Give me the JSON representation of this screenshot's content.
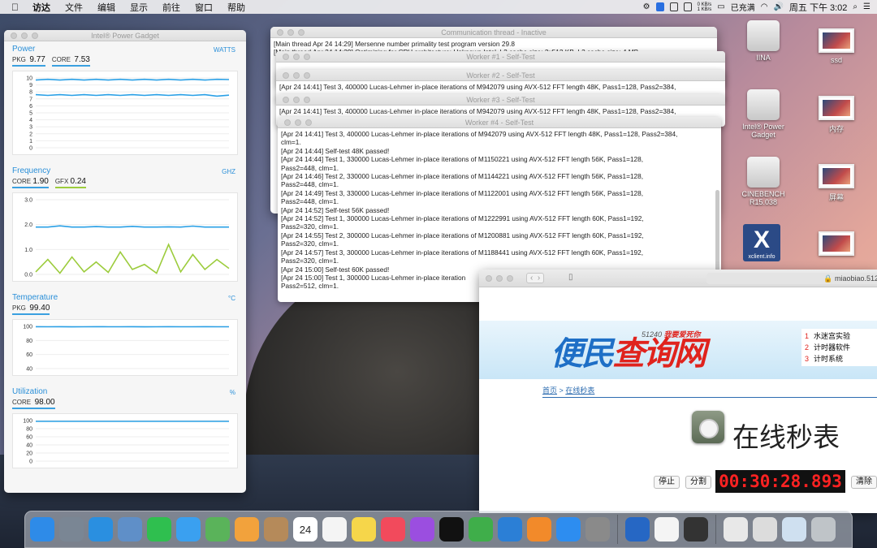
{
  "menubar": {
    "apple_icon": "apple-logo",
    "items": [
      "访达",
      "文件",
      "编辑",
      "显示",
      "前往",
      "窗口",
      "帮助"
    ],
    "net_up": "0 KB/s",
    "net_down": "1 KB/s",
    "battery": "已充满",
    "clock": "周五 下午 3:02"
  },
  "power_gadget": {
    "title": "Intel® Power Gadget",
    "power": {
      "title": "Power",
      "unit": "WATTS",
      "pkg_label": "PKG",
      "pkg_value": "9.77",
      "core_label": "CORE",
      "core_value": "7.53",
      "yticks": [
        "10",
        "9",
        "8",
        "7",
        "6",
        "5",
        "4",
        "3",
        "2",
        "1",
        "0"
      ]
    },
    "frequency": {
      "title": "Frequency",
      "unit": "GHZ",
      "core_label": "CORE",
      "core_value": "1.90",
      "gfx_label": "GFX",
      "gfx_value": "0.24",
      "yticks": [
        "3.0",
        "2.0",
        "1.0",
        "0.0"
      ]
    },
    "temperature": {
      "title": "Temperature",
      "unit": "°C",
      "pkg_label": "PKG",
      "pkg_value": "99.40",
      "yticks": [
        "100",
        "80",
        "60",
        "40"
      ]
    },
    "utilization": {
      "title": "Utilization",
      "unit": "%",
      "core_label": "CORE",
      "core_value": "98.00",
      "yticks": [
        "100",
        "80",
        "60",
        "40",
        "20",
        "0"
      ]
    }
  },
  "chart_data": [
    {
      "type": "line",
      "title": "Power",
      "ylim": [
        0,
        10
      ],
      "series": [
        {
          "name": "PKG",
          "values": [
            9.7,
            9.8,
            9.7,
            9.8,
            9.7,
            9.8,
            9.7,
            9.8,
            9.7,
            9.8,
            9.7,
            9.8,
            9.7,
            9.8,
            9.7,
            9.8,
            9.77
          ]
        },
        {
          "name": "CORE",
          "values": [
            7.6,
            7.5,
            7.6,
            7.5,
            7.6,
            7.5,
            7.6,
            7.5,
            7.6,
            7.5,
            7.6,
            7.5,
            7.6,
            7.5,
            7.6,
            7.4,
            7.53
          ]
        }
      ]
    },
    {
      "type": "line",
      "title": "Frequency",
      "ylim": [
        0,
        3
      ],
      "series": [
        {
          "name": "CORE",
          "values": [
            1.9,
            1.9,
            1.95,
            1.9,
            1.9,
            1.92,
            1.9,
            1.9,
            1.93,
            1.9,
            1.9,
            1.91,
            1.9,
            1.94,
            1.9,
            1.9,
            1.9
          ]
        },
        {
          "name": "GFX",
          "values": [
            0.1,
            0.6,
            0.05,
            0.7,
            0.1,
            0.5,
            0.08,
            0.9,
            0.2,
            0.4,
            0.05,
            1.2,
            0.1,
            0.8,
            0.2,
            0.6,
            0.24
          ]
        }
      ]
    },
    {
      "type": "line",
      "title": "Temperature",
      "ylim": [
        40,
        100
      ],
      "series": [
        {
          "name": "PKG",
          "values": [
            99.5,
            99.4,
            99.5,
            99.3,
            99.4,
            99.5,
            99.4,
            99.4,
            99.5,
            99.3,
            99.4,
            99.5,
            99.4,
            99.4,
            99.5,
            99.4,
            99.4
          ]
        }
      ]
    },
    {
      "type": "line",
      "title": "Utilization",
      "ylim": [
        0,
        100
      ],
      "series": [
        {
          "name": "CORE",
          "values": [
            98,
            98,
            98,
            98,
            98,
            98,
            98,
            98,
            98,
            98,
            98,
            98,
            98,
            98,
            98,
            98,
            98
          ]
        }
      ]
    }
  ],
  "prime95": {
    "comm_title": "Communication thread - Inactive",
    "comm_lines": [
      "[Main thread Apr 24 14:29] Mersenne number primality test program version 29.8",
      "[Main thread Apr 24 14:29] Optimizing for CPU architecture: Unknown Intel, L2 cache size: 2x512 KB, L3 cache size: 4 MB"
    ],
    "worker_titles": [
      "Worker #1 - Self-Test",
      "Worker #2 - Self-Test",
      "Worker #3 - Self-Test",
      "Worker #4 - Self-Test"
    ],
    "worker2_line": "[Apr 24 14:41] Test 3, 400000 Lucas-Lehmer in-place iterations of M942079 using AVX-512 FFT length 48K, Pass1=128, Pass2=384,",
    "worker3_line": "[Apr 24 14:41] Test 3, 400000 Lucas-Lehmer in-place iterations of M942079 using AVX-512 FFT length 48K, Pass1=128, Pass2=384,",
    "worker4_lines": [
      "[Apr 24 14:41] Test 3, 400000 Lucas-Lehmer in-place iterations of M942079 using AVX-512 FFT length 48K, Pass1=128, Pass2=384,",
      "clm=1.",
      "[Apr 24 14:44] Self-test 48K passed!",
      "[Apr 24 14:44] Test 1, 330000 Lucas-Lehmer in-place iterations of M1150221 using AVX-512 FFT length 56K, Pass1=128,",
      "Pass2=448, clm=1.",
      "[Apr 24 14:46] Test 2, 330000 Lucas-Lehmer in-place iterations of M1144221 using AVX-512 FFT length 56K, Pass1=128,",
      "Pass2=448, clm=1.",
      "[Apr 24 14:49] Test 3, 330000 Lucas-Lehmer in-place iterations of M1122001 using AVX-512 FFT length 56K, Pass1=128,",
      "Pass2=448, clm=1.",
      "[Apr 24 14:52] Self-test 56K passed!",
      "[Apr 24 14:52] Test 1, 300000 Lucas-Lehmer in-place iterations of M1222991 using AVX-512 FFT length 60K, Pass1=192,",
      "Pass2=320, clm=1.",
      "[Apr 24 14:55] Test 2, 300000 Lucas-Lehmer in-place iterations of M1200881 using AVX-512 FFT length 60K, Pass1=192,",
      "Pass2=320, clm=1.",
      "[Apr 24 14:57] Test 3, 300000 Lucas-Lehmer in-place iterations of M1188441 using AVX-512 FFT length 60K, Pass1=192,",
      "Pass2=320, clm=1.",
      "[Apr 24 15:00] Self-test 60K passed!",
      "[Apr 24 15:00] Test 1, 300000 Lucas-Lehmer in-place iteration",
      "Pass2=512, clm=1."
    ]
  },
  "browser": {
    "url": "miaobiao.512",
    "logo_text_1": "便民",
    "logo_text_2": "查询网",
    "slogan_num": "51240",
    "slogan_text": "我要爱死你",
    "side_links": [
      {
        "n": "1",
        "label": "水迷宫实验"
      },
      {
        "n": "2",
        "label": "计时器软件"
      },
      {
        "n": "3",
        "label": "计时系统"
      }
    ],
    "crumb_home": "首页",
    "crumb_sep": ">",
    "crumb_page": "在线秒表",
    "page_title": "在线秒表",
    "stop_label": "停止",
    "split_label": "分割",
    "timer_value": "00:30:28.893",
    "clear_label": "清除"
  },
  "desktop": {
    "icons": [
      {
        "label": "IINA"
      },
      {
        "label": "ssd"
      },
      {
        "label": "Intel® Power Gadget"
      },
      {
        "label": "内存"
      },
      {
        "label": "CINEBENCH R15.038"
      },
      {
        "label": "屏幕"
      },
      {
        "label": "xclient.info"
      }
    ],
    "calendar_day": "24"
  },
  "dock": {
    "apps": [
      "finder-icon",
      "launchpad-icon",
      "safari-icon",
      "preview-icon",
      "facetime-icon",
      "messages-icon",
      "maps-icon",
      "photos-icon",
      "contacts-icon",
      "calendar-icon",
      "reminders-icon",
      "notes-icon",
      "music-icon",
      "podcasts-icon",
      "appletv-icon",
      "numbers-icon",
      "keynote-icon",
      "pages-icon",
      "appstore-icon",
      "settings-icon",
      "powergadget-icon",
      "textedit-icon",
      "prime95-icon",
      "downloads-icon",
      "stack-icon",
      "screenshot-icon",
      "trash-icon"
    ]
  }
}
